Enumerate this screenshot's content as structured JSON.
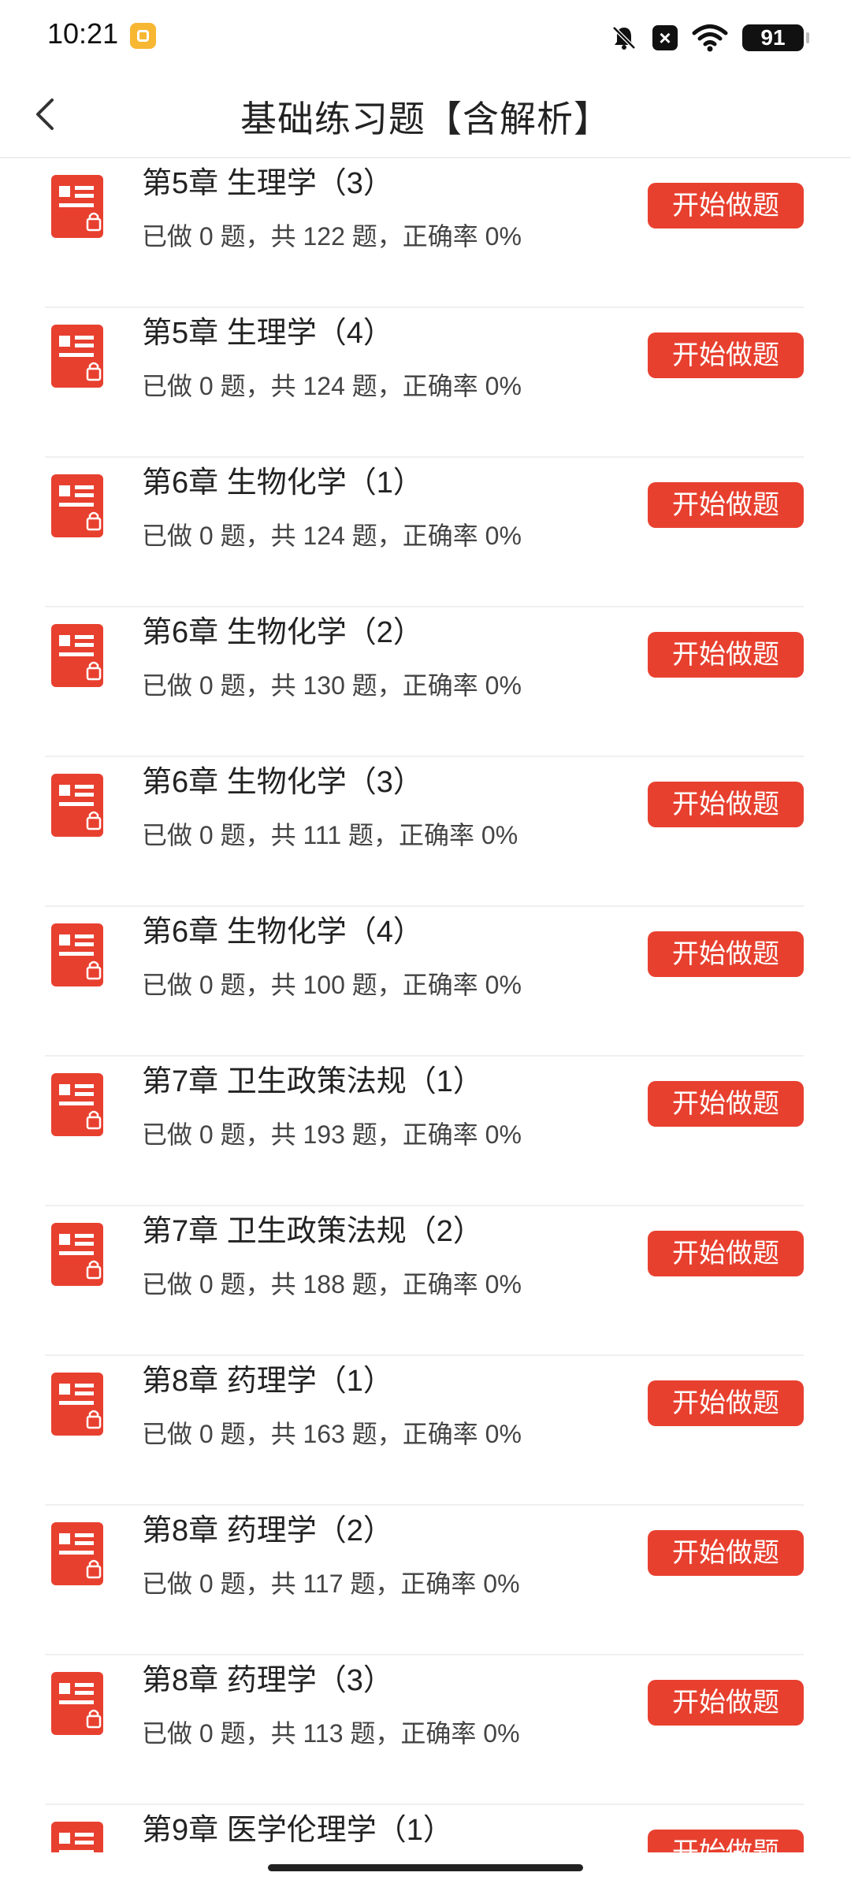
{
  "status_bar": {
    "time": "10:21",
    "battery": "91"
  },
  "header": {
    "title": "基础练习题【含解析】"
  },
  "items": [
    {
      "title": "第5章 生理学（3）",
      "stats": "已做 0 题，共 122 题，正确率 0%",
      "button": "开始做题"
    },
    {
      "title": "第5章 生理学（4）",
      "stats": "已做 0 题，共 124 题，正确率 0%",
      "button": "开始做题"
    },
    {
      "title": "第6章 生物化学（1）",
      "stats": "已做 0 题，共 124 题，正确率 0%",
      "button": "开始做题"
    },
    {
      "title": "第6章 生物化学（2）",
      "stats": "已做 0 题，共 130 题，正确率 0%",
      "button": "开始做题"
    },
    {
      "title": "第6章 生物化学（3）",
      "stats": "已做 0 题，共 111 题，正确率 0%",
      "button": "开始做题"
    },
    {
      "title": "第6章 生物化学（4）",
      "stats": "已做 0 题，共 100 题，正确率 0%",
      "button": "开始做题"
    },
    {
      "title": "第7章 卫生政策法规（1）",
      "stats": "已做 0 题，共 193 题，正确率 0%",
      "button": "开始做题"
    },
    {
      "title": "第7章 卫生政策法规（2）",
      "stats": "已做 0 题，共 188 题，正确率 0%",
      "button": "开始做题"
    },
    {
      "title": "第8章 药理学（1）",
      "stats": "已做 0 题，共 163 题，正确率 0%",
      "button": "开始做题"
    },
    {
      "title": "第8章 药理学（2）",
      "stats": "已做 0 题，共 117 题，正确率 0%",
      "button": "开始做题"
    },
    {
      "title": "第8章 药理学（3）",
      "stats": "已做 0 题，共 113 题，正确率 0%",
      "button": "开始做题"
    },
    {
      "title": "第9章 医学伦理学（1）",
      "stats": "",
      "button": "开始做题"
    }
  ],
  "colors": {
    "accent": "#e8402f",
    "icon": "#e8402f"
  },
  "icons": {
    "back": "chevron-left-icon",
    "item": "locked-document-icon"
  }
}
